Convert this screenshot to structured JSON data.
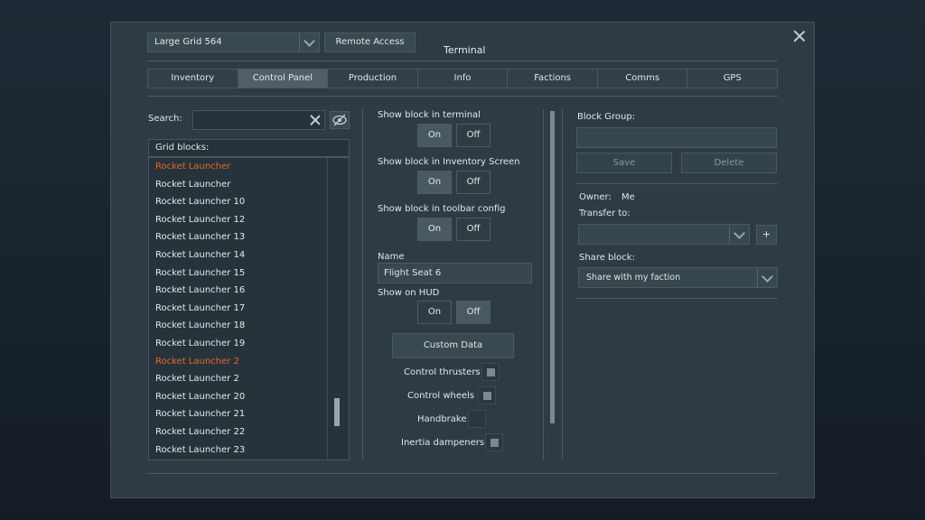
{
  "header": {
    "grid_select": "Large Grid 564",
    "remote_access_label": "Remote Access",
    "title": "Terminal"
  },
  "tabs": [
    {
      "label": "Inventory"
    },
    {
      "label": "Control Panel"
    },
    {
      "label": "Production"
    },
    {
      "label": "Info"
    },
    {
      "label": "Factions"
    },
    {
      "label": "Comms"
    },
    {
      "label": "GPS"
    }
  ],
  "active_tab": "Control Panel",
  "search": {
    "label": "Search:",
    "value": ""
  },
  "grid_blocks": {
    "header": "Grid blocks:",
    "items": [
      {
        "label": "Rocket Launcher",
        "highlight": true
      },
      {
        "label": "Rocket Launcher"
      },
      {
        "label": "Rocket Launcher 10"
      },
      {
        "label": "Rocket Launcher 12"
      },
      {
        "label": "Rocket Launcher 13"
      },
      {
        "label": "Rocket Launcher 14"
      },
      {
        "label": "Rocket Launcher 15"
      },
      {
        "label": "Rocket Launcher 16"
      },
      {
        "label": "Rocket Launcher 17"
      },
      {
        "label": "Rocket Launcher 18"
      },
      {
        "label": "Rocket Launcher 19"
      },
      {
        "label": "Rocket Launcher 2",
        "highlight": true
      },
      {
        "label": "Rocket Launcher 2"
      },
      {
        "label": "Rocket Launcher 20"
      },
      {
        "label": "Rocket Launcher 21"
      },
      {
        "label": "Rocket Launcher 22"
      },
      {
        "label": "Rocket Launcher 23"
      }
    ],
    "highlight_color": "#e06a2e"
  },
  "control": {
    "show_terminal_label": "Show block in terminal",
    "show_inventory_label": "Show block in Inventory Screen",
    "show_toolbar_label": "Show block in toolbar config",
    "name_label": "Name",
    "name_value": "Flight Seat 6",
    "show_hud_label": "Show on HUD",
    "on_label": "On",
    "off_label": "Off",
    "custom_data_label": "Custom Data",
    "checks": [
      {
        "label": "Control thrusters"
      },
      {
        "label": "Control wheels"
      },
      {
        "label": "Handbrake"
      },
      {
        "label": "Inertia dampeners"
      }
    ]
  },
  "right": {
    "block_group_label": "Block Group:",
    "save_label": "Save",
    "delete_label": "Delete",
    "owner_label": "Owner:",
    "owner_value": "Me",
    "transfer_label": "Transfer to:",
    "plus_label": "+",
    "share_label": "Share block:",
    "share_value": "Share with my faction"
  }
}
